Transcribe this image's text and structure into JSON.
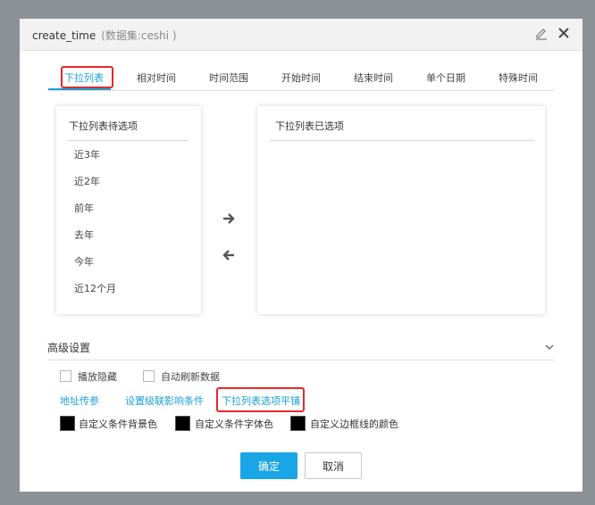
{
  "dialog": {
    "title": "create_time",
    "subtitle": "(数据集:ceshi )",
    "icons": {
      "edit": "pencil-icon",
      "close": "close-icon"
    }
  },
  "tabs": [
    {
      "label": "下拉列表",
      "active": true
    },
    {
      "label": "相对时间",
      "active": false
    },
    {
      "label": "时间范围",
      "active": false
    },
    {
      "label": "开始时间",
      "active": false
    },
    {
      "label": "结束时间",
      "active": false
    },
    {
      "label": "单个日期",
      "active": false
    },
    {
      "label": "特殊时间",
      "active": false
    }
  ],
  "available": {
    "header": "下拉列表待选项",
    "items": [
      "近3年",
      "近2年",
      "前年",
      "去年",
      "今年",
      "近12个月"
    ]
  },
  "selected": {
    "header": "下拉列表已选项",
    "items": []
  },
  "transfer": {
    "add_icon": "arrow-right-icon",
    "remove_icon": "arrow-left-icon"
  },
  "advanced": {
    "title": "高级设置",
    "chevron_icon": "chevron-down-icon",
    "checkboxes": [
      {
        "label": "播放隐藏",
        "checked": false
      },
      {
        "label": "自动刷新数据",
        "checked": false
      }
    ],
    "links": [
      "地址传参",
      "设置级联影响条件",
      "下拉列表选项平铺"
    ],
    "colors": [
      {
        "label": "自定义条件背景色",
        "value": "#000000"
      },
      {
        "label": "自定义条件字体色",
        "value": "#000000"
      },
      {
        "label": "自定义边框线的颜色",
        "value": "#000000"
      }
    ]
  },
  "buttons": {
    "confirm": "确定",
    "cancel": "取消"
  },
  "theme": {
    "accent": "#1a9fd9",
    "highlight": "#e8282b",
    "overlay": "#8c9196"
  }
}
